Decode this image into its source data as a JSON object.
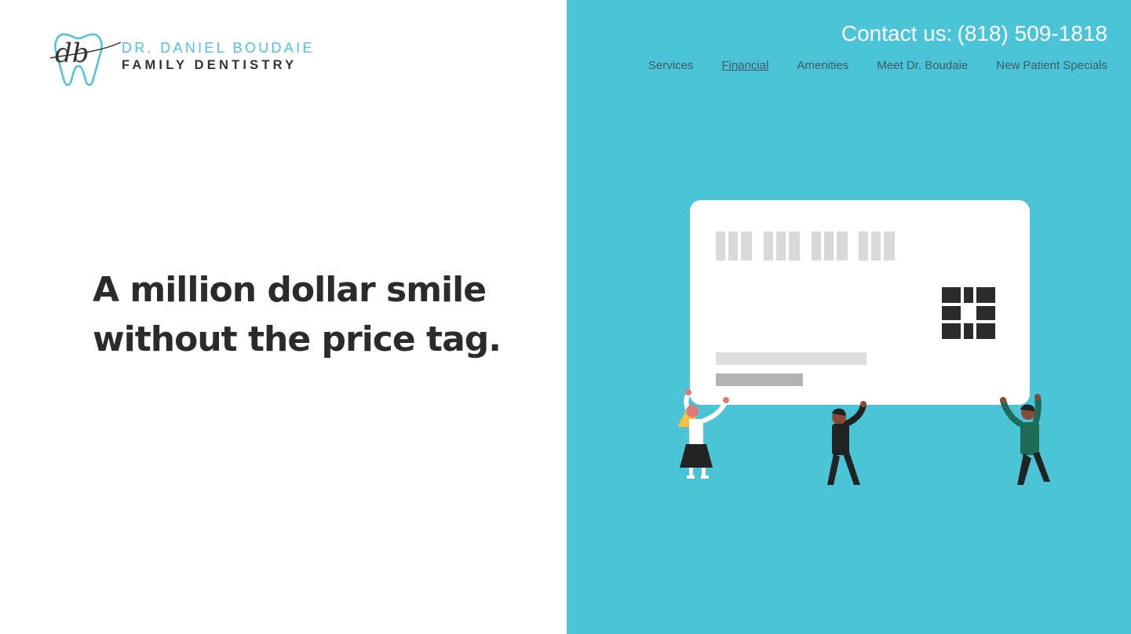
{
  "logo": {
    "monogram": "db",
    "line1": "DR. DANIEL BOUDAIE",
    "line2": "FAMILY DENTISTRY",
    "color": "#4cc4d8"
  },
  "hero": {
    "headline_line1": "A million dollar smile",
    "headline_line2": "without the price tag."
  },
  "header": {
    "contact_label": "Contact us:",
    "contact_phone": "(818) 509-1818"
  },
  "nav": {
    "items": [
      {
        "label": "Services",
        "active": false
      },
      {
        "label": "Financial",
        "active": true
      },
      {
        "label": "Amenities",
        "active": false
      },
      {
        "label": "Meet Dr. Boudaie",
        "active": false
      },
      {
        "label": "New Patient Specials",
        "active": false
      }
    ]
  },
  "illustration": {
    "subject": "credit-card-held-by-people",
    "background_color": "#4cc4d8"
  }
}
